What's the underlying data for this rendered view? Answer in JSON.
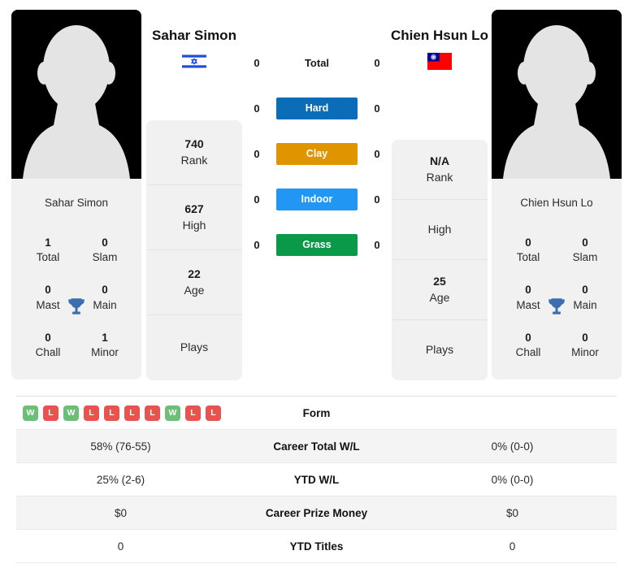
{
  "players": {
    "left": {
      "name": "Sahar Simon",
      "photo_caption": "Sahar Simon",
      "flag": "israel-flag",
      "titles": [
        {
          "value": "1",
          "label": "Total"
        },
        {
          "value": "0",
          "label": "Slam"
        },
        {
          "value": "0",
          "label": "Mast"
        },
        {
          "value": "0",
          "label": "Main"
        },
        {
          "value": "0",
          "label": "Chall"
        },
        {
          "value": "1",
          "label": "Minor"
        }
      ],
      "info": [
        {
          "value": "740",
          "label": "Rank"
        },
        {
          "value": "627",
          "label": "High"
        },
        {
          "value": "22",
          "label": "Age"
        },
        {
          "value": "",
          "label": "Plays"
        }
      ]
    },
    "right": {
      "name": "Chien Hsun Lo",
      "photo_caption": "Chien Hsun Lo",
      "flag": "taiwan-flag",
      "titles": [
        {
          "value": "0",
          "label": "Total"
        },
        {
          "value": "0",
          "label": "Slam"
        },
        {
          "value": "0",
          "label": "Mast"
        },
        {
          "value": "0",
          "label": "Main"
        },
        {
          "value": "0",
          "label": "Chall"
        },
        {
          "value": "0",
          "label": "Minor"
        }
      ],
      "info": [
        {
          "value": "N/A",
          "label": "Rank"
        },
        {
          "value": "",
          "label": "High"
        },
        {
          "value": "25",
          "label": "Age"
        },
        {
          "value": "",
          "label": "Plays"
        }
      ]
    }
  },
  "surfaces": [
    {
      "label": "Total",
      "left": "0",
      "right": "0",
      "color": "",
      "plain": true
    },
    {
      "label": "Hard",
      "left": "0",
      "right": "0",
      "color": "#0b6cb8",
      "plain": false
    },
    {
      "label": "Clay",
      "left": "0",
      "right": "0",
      "color": "#e09400",
      "plain": false
    },
    {
      "label": "Indoor",
      "left": "0",
      "right": "0",
      "color": "#2196f3",
      "plain": false
    },
    {
      "label": "Grass",
      "left": "0",
      "right": "0",
      "color": "#0a9949",
      "plain": false
    }
  ],
  "stats_table": [
    {
      "label": "Form",
      "left_form": [
        "W",
        "L",
        "W",
        "L",
        "L",
        "L",
        "L",
        "W",
        "L",
        "L"
      ],
      "right_form": [],
      "left": "",
      "right": ""
    },
    {
      "label": "Career Total W/L",
      "left": "58% (76-55)",
      "right": "0% (0-0)"
    },
    {
      "label": "YTD W/L",
      "left": "25% (2-6)",
      "right": "0% (0-0)"
    },
    {
      "label": "Career Prize Money",
      "left": "$0",
      "right": "$0"
    },
    {
      "label": "YTD Titles",
      "left": "0",
      "right": "0"
    }
  ],
  "colors": {
    "win_badge": "#6cbf76",
    "loss_badge": "#e8534f",
    "trophy": "#3b6fae",
    "card_bg": "#f1f1f1",
    "row_stripe": "#f4f4f4"
  }
}
